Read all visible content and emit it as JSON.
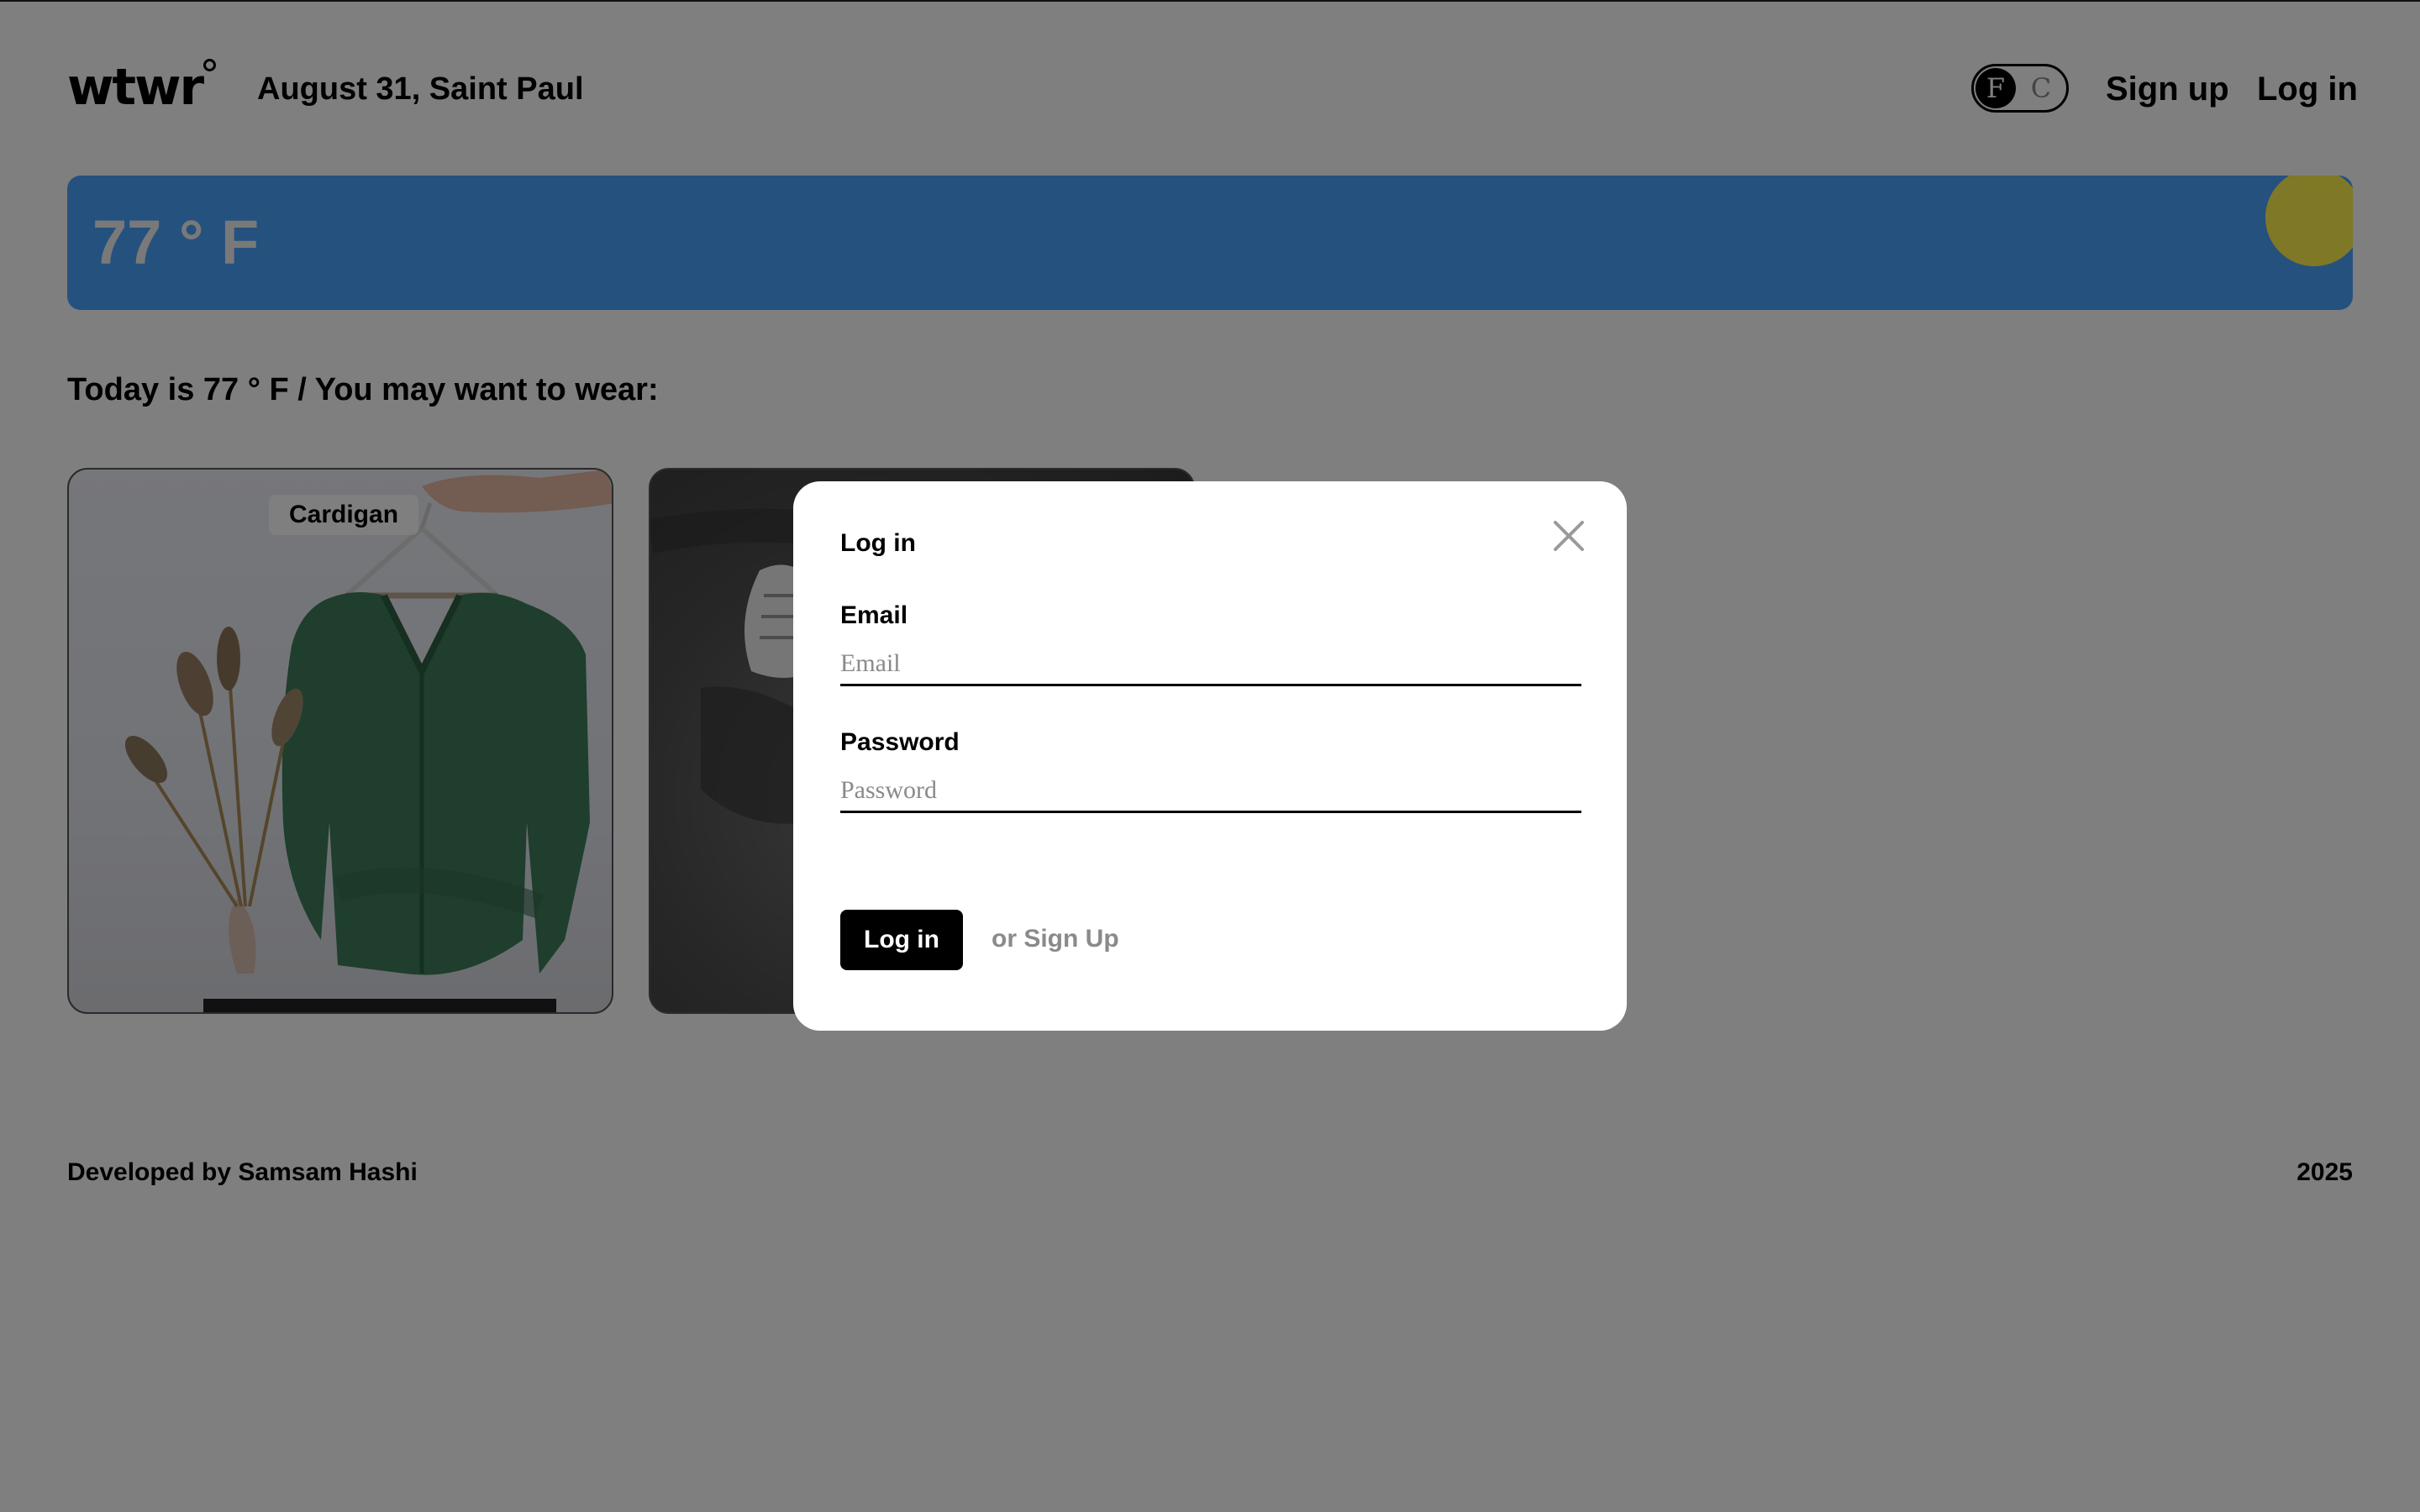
{
  "header": {
    "logo": "wtwr",
    "date_location": "August 31, Saint Paul",
    "unit_toggle": {
      "f_label": "F",
      "c_label": "C",
      "selected": "F"
    },
    "signup_label": "Sign up",
    "login_label": "Log in"
  },
  "weather": {
    "temperature": "77 ° F",
    "banner_color": "#4aa3ff",
    "sun_color": "#fff04f"
  },
  "main": {
    "today_text": "Today is 77 ° F / You may want to wear:",
    "cards": [
      {
        "label": "Cardigan",
        "image": "green-cardigan-on-hanger"
      },
      {
        "label": "",
        "image": "sneakers-on-dark-ground"
      }
    ]
  },
  "footer": {
    "developer": "Developed by Samsam Hashi",
    "year": "2025"
  },
  "modal": {
    "title": "Log in",
    "close_icon": "close-icon",
    "email_label": "Email",
    "email_placeholder": "Email",
    "password_label": "Password",
    "password_placeholder": "Password",
    "submit_label": "Log in",
    "alt_link": "or Sign Up"
  },
  "colors": {
    "overlay": "rgba(0,0,0,0.5)",
    "button_bg": "#000000",
    "muted_text": "#8a8a8a"
  }
}
